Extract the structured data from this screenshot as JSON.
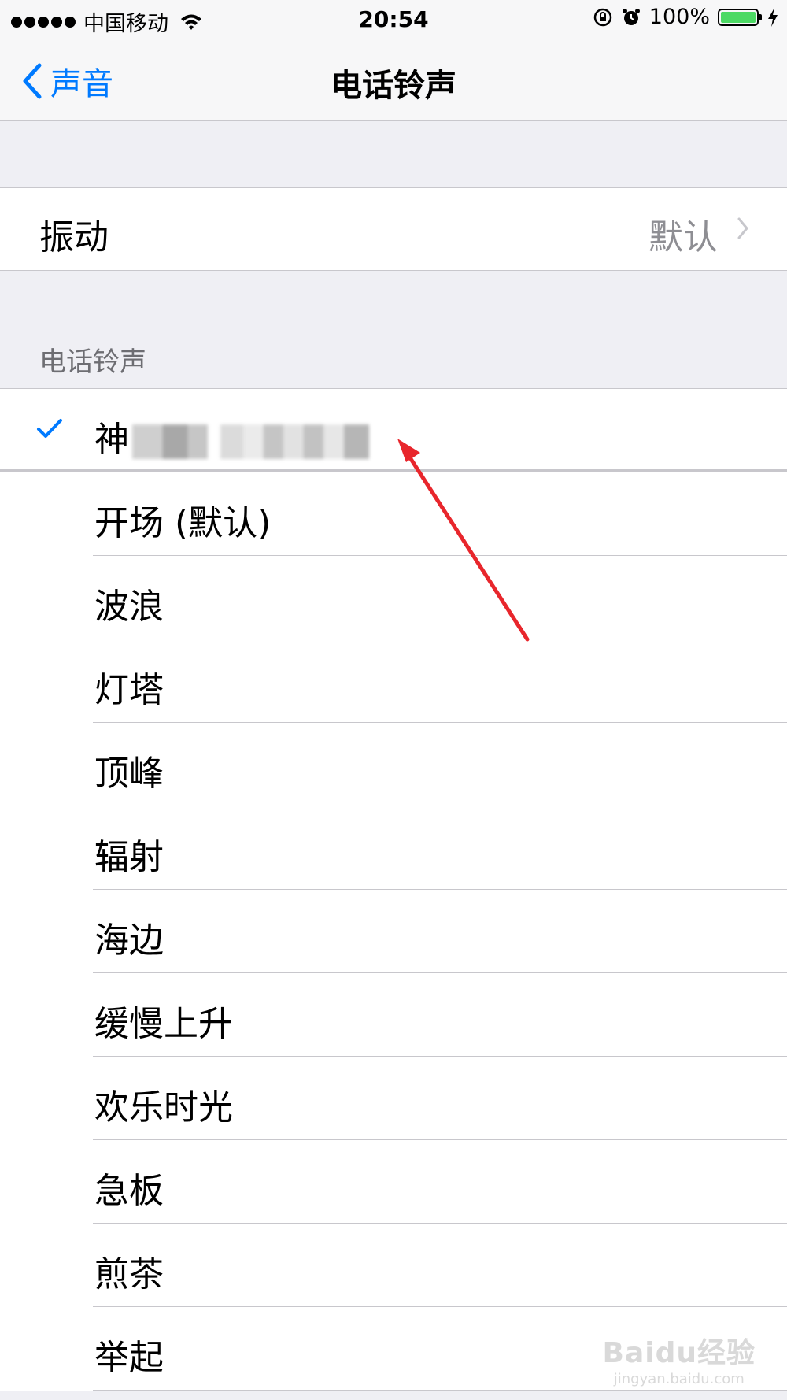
{
  "status_bar": {
    "carrier": "中国移动",
    "time": "20:54",
    "battery_percent": "100%",
    "battery_level": 1.0
  },
  "nav": {
    "back_label": "声音",
    "title": "电话铃声"
  },
  "vibration": {
    "label": "振动",
    "value": "默认"
  },
  "section_header": "电话铃声",
  "ringtones": [
    {
      "label": "神",
      "selected": true,
      "obscured": true
    },
    {
      "label": "开场 (默认)"
    },
    {
      "label": "波浪"
    },
    {
      "label": "灯塔"
    },
    {
      "label": "顶峰"
    },
    {
      "label": "辐射"
    },
    {
      "label": "海边"
    },
    {
      "label": "缓慢上升"
    },
    {
      "label": "欢乐时光"
    },
    {
      "label": "急板"
    },
    {
      "label": "煎茶"
    },
    {
      "label": "举起"
    }
  ],
  "colors": {
    "accent": "#007aff",
    "annotation_arrow": "#e8262c",
    "battery": "#4cd964"
  },
  "watermark": {
    "main": "Baidu经验",
    "sub": "jingyan.baidu.com"
  }
}
